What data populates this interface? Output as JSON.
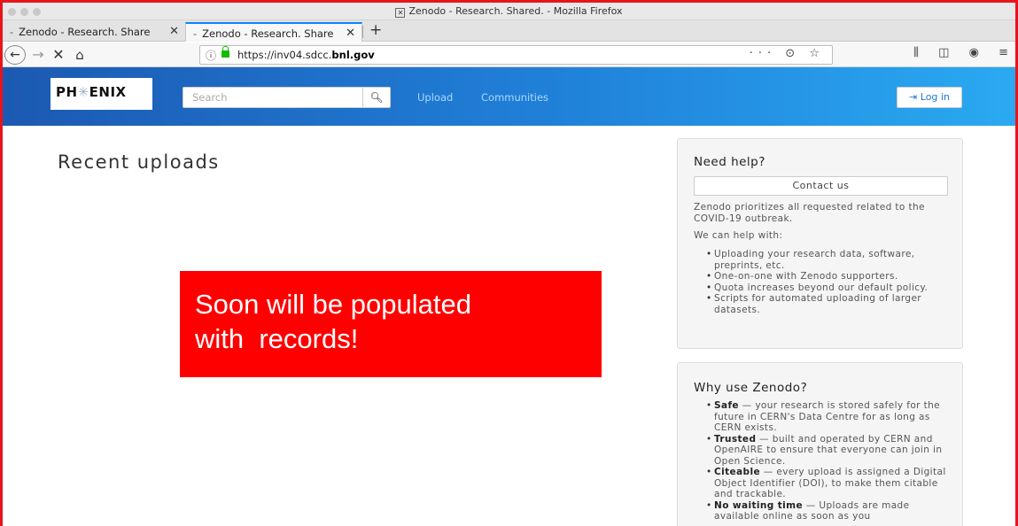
{
  "window": {
    "title": "Zenodo - Research. Shared. - Mozilla Firefox"
  },
  "tabs": [
    {
      "label": "Zenodo - Research. Share"
    },
    {
      "label": "Zenodo - Research. Share"
    }
  ],
  "nav": {
    "url_prefix": "https://inv04.sdcc.",
    "url_domain": "bnl.gov",
    "url_actions": "··· ⊙ ☆"
  },
  "header": {
    "logo_left": "PH",
    "logo_star": "✳",
    "logo_right": "ENIX",
    "search_placeholder": "Search",
    "upload_label": "Upload",
    "communities_label": "Communities",
    "login_label": "Log in"
  },
  "main": {
    "title": "Recent uploads",
    "banner_line1": "Soon will be populated",
    "banner_line2": "with  records!"
  },
  "help": {
    "title": "Need help?",
    "contact_label": "Contact us",
    "covid_text": "Zenodo prioritizes all requested related to the COVID-19 outbreak.",
    "help_intro": "We can help with:",
    "items": [
      "Uploading your research data, software, preprints, etc.",
      "One-on-one with Zenodo supporters.",
      "Quota increases beyond our default policy.",
      "Scripts for automated uploading of larger datasets."
    ]
  },
  "why": {
    "title": "Why use Zenodo?",
    "items": [
      {
        "term": "Safe",
        "text": " — your research is stored safely for the future in CERN's Data Centre for as long as CERN exists."
      },
      {
        "term": "Trusted",
        "text": " — built and operated by CERN and OpenAIRE to ensure that everyone can join in Open Science."
      },
      {
        "term": "Citeable",
        "text": " — every upload is assigned a Digital Object Identifier (DOI), to make them citable and trackable."
      },
      {
        "term": "No waiting time",
        "text": " — Uploads are made available online as soon as you"
      }
    ]
  },
  "colors": {
    "accent": "#0a84ff",
    "header_start": "#1c59b2",
    "header_end": "#2aa9f1",
    "banner": "#ff0000",
    "frame": "#e8141b"
  }
}
